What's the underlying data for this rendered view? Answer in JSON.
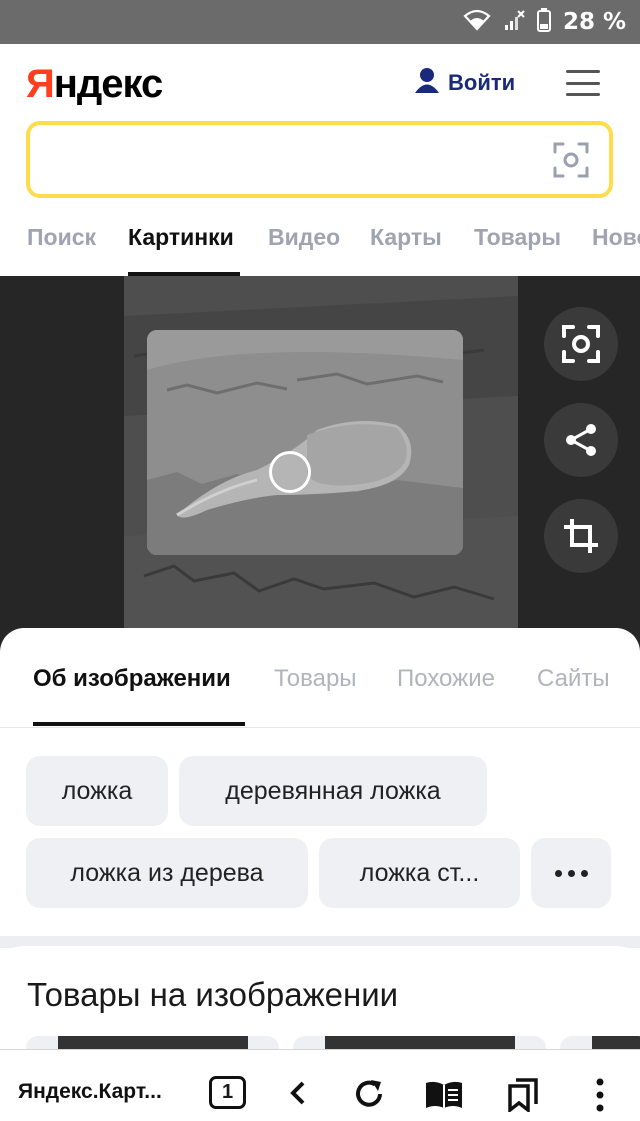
{
  "status_bar": {
    "battery_text": "28 %",
    "icons": [
      "wifi-icon",
      "no-signal-icon",
      "battery-icon"
    ]
  },
  "header": {
    "logo_first": "Я",
    "logo_rest": "ндекс",
    "login_label": "Войти",
    "login_icon": "user-icon",
    "menu_icon": "hamburger-menu-icon"
  },
  "search": {
    "value": "",
    "placeholder": "",
    "camera_icon": "image-search-icon",
    "accent_color": "#ffdb4d"
  },
  "services": {
    "items": [
      {
        "label": "Поиск",
        "active": false
      },
      {
        "label": "Картинки",
        "active": true
      },
      {
        "label": "Видео",
        "active": false
      },
      {
        "label": "Карты",
        "active": false
      },
      {
        "label": "Товары",
        "active": false
      },
      {
        "label": "Новости",
        "active": false
      }
    ]
  },
  "viewer": {
    "actions": [
      "image-search-icon",
      "share-icon",
      "crop-icon"
    ]
  },
  "sheet": {
    "tabs": [
      {
        "label": "Об изображении",
        "active": true
      },
      {
        "label": "Товары",
        "active": false
      },
      {
        "label": "Похожие",
        "active": false
      },
      {
        "label": "Сайты",
        "active": false
      }
    ],
    "tags": [
      "ложка",
      "деревянная ложка",
      "ложка из дерева",
      "ложка ст..."
    ],
    "more_icon": "more-horizontal-icon"
  },
  "products": {
    "title": "Товары на изображении"
  },
  "browser_bar": {
    "title": "Яндекс.Карт...",
    "tab_count": "1",
    "icons": [
      "back-icon",
      "reload-icon",
      "reader-icon",
      "bookmarks-icon",
      "more-vertical-icon"
    ]
  },
  "colors": {
    "brand_red": "#fc3f1d",
    "login_blue": "#1a2a7a",
    "inactive_tab": "#a0a4b0",
    "chip_bg": "#eff0f3"
  }
}
